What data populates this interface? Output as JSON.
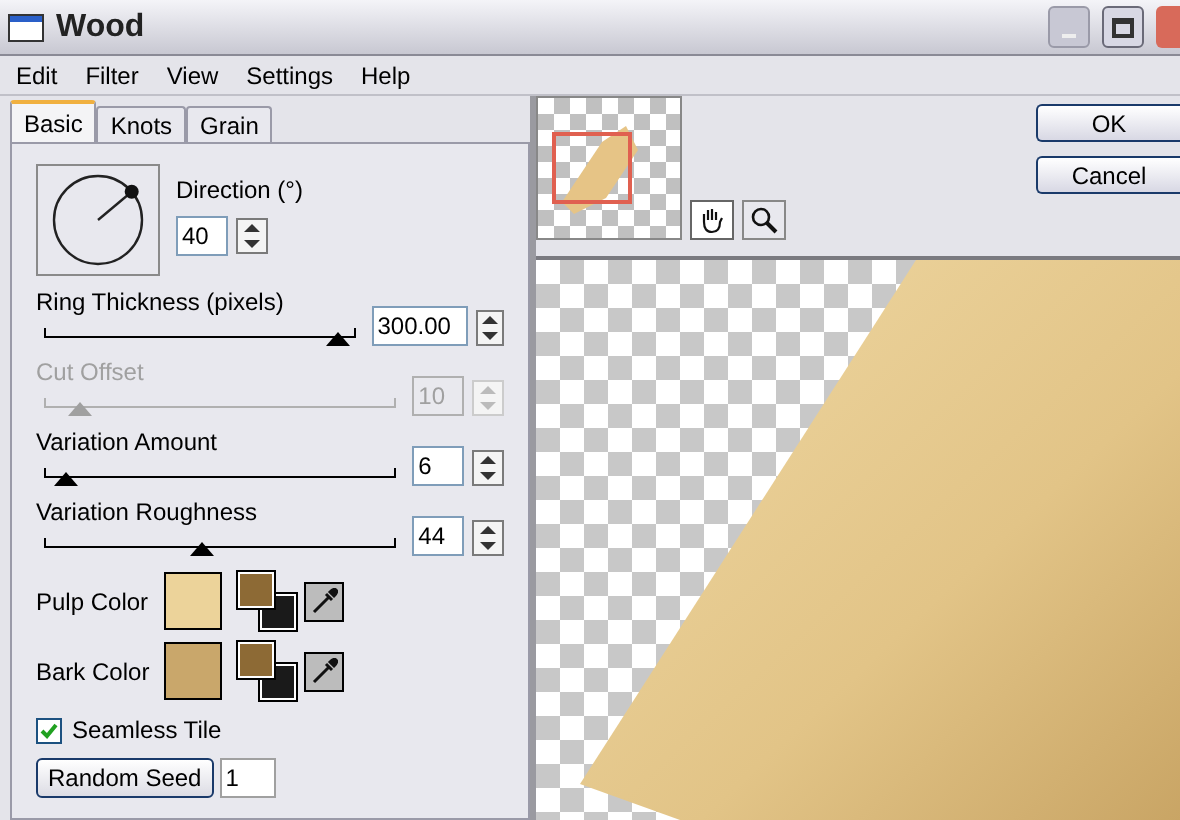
{
  "window": {
    "title": "Wood"
  },
  "menu": [
    "Edit",
    "Filter",
    "View",
    "Settings",
    "Help"
  ],
  "tabs": [
    {
      "label": "Basic",
      "selected": true
    },
    {
      "label": "Knots",
      "selected": false
    },
    {
      "label": "Grain",
      "selected": false
    }
  ],
  "direction": {
    "label": "Direction (°)",
    "value": "40"
  },
  "sliders": [
    {
      "label": "Ring Thickness (pixels)",
      "value": "300.00",
      "level": 0.92,
      "disabled": false
    },
    {
      "label": "Cut Offset",
      "value": "10",
      "level": 0.1,
      "disabled": true
    },
    {
      "label": "Variation Amount",
      "value": "6",
      "level": 0.06,
      "disabled": false
    },
    {
      "label": "Variation Roughness",
      "value": "44",
      "level": 0.44,
      "disabled": false
    }
  ],
  "colors": [
    {
      "label": "Pulp Color",
      "color": "#ecd39a"
    },
    {
      "label": "Bark Color",
      "color": "#c9a76b"
    }
  ],
  "seamless_tile": {
    "label": "Seamless Tile",
    "checked": true
  },
  "random_seed": {
    "label": "Random Seed",
    "value": "1"
  },
  "buttons": [
    "OK",
    "Cancel"
  ]
}
